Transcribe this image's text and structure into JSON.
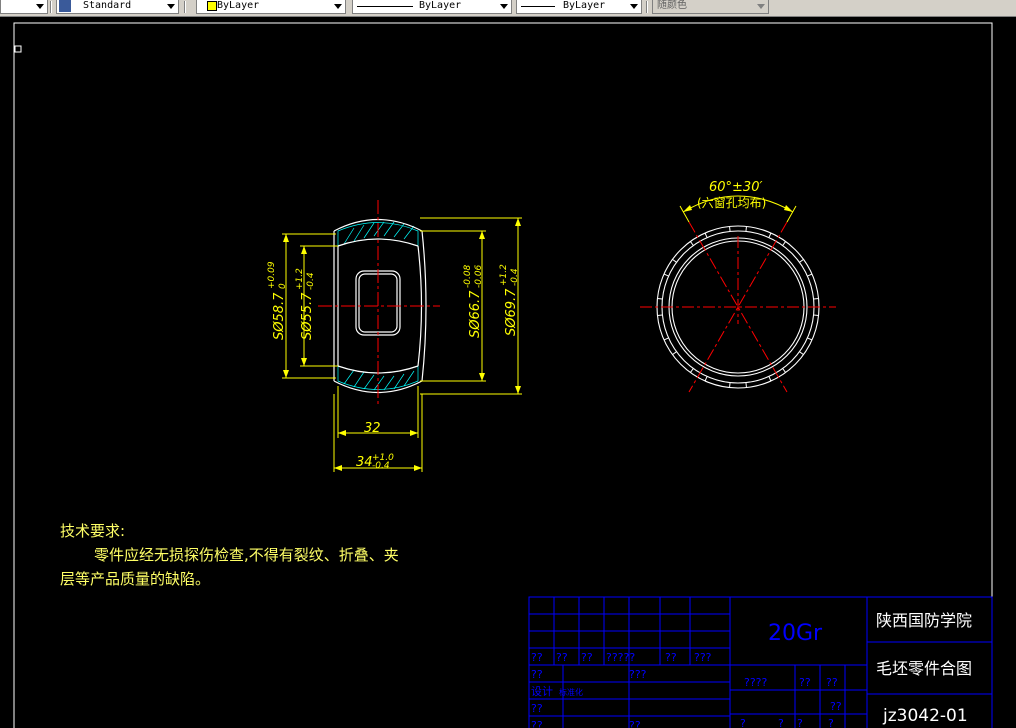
{
  "toolbar": {
    "textstyle_value": "Standard",
    "layer_color_value": "ByLayer",
    "linetype_value": "ByLayer",
    "lineweight_value": "ByLayer",
    "plotstyle_value": "随颜色"
  },
  "colors": {
    "background": "#000000",
    "object": "#ffffff",
    "dimension": "#ffff00",
    "centerline": "#ff0000",
    "hatch": "#00ffff",
    "titleblock": "#0000ff",
    "note": "#ffff66"
  },
  "drawing": {
    "dim_sphere_58": "SØ58.7",
    "dim_sphere_58_tol_upper": "+0.09",
    "dim_sphere_58_tol_lower": "0",
    "dim_sphere_55": "SØ55.7",
    "dim_sphere_55_tol_upper": "+1.2",
    "dim_sphere_55_tol_lower": "-0.4",
    "dim_sphere_66": "SØ66.7",
    "dim_sphere_66_tol_upper": "-0.08",
    "dim_sphere_66_tol_lower": "-0.06",
    "dim_sphere_69": "SØ69.7",
    "dim_sphere_69_tol_upper": "+1.2",
    "dim_sphere_69_tol_lower": "-0.4",
    "dim_width_32": "32",
    "dim_width_34": "34",
    "dim_width_34_tol_upper": "+1.0",
    "dim_width_34_tol_lower": "-0.4",
    "angle_label": "60°±30′",
    "angle_note": "(六窗孔均布)"
  },
  "notes": {
    "heading": "技术要求:",
    "line1": "零件应经无损探伤检查,不得有裂纹、折叠、夹",
    "line2": "层等产品质量的缺陷。"
  },
  "title_block": {
    "material": "20Gr",
    "school": "陕西国防学院",
    "title": "毛坯零件合图",
    "drawing_no": "jz3042-01",
    "placeholder_a": "??",
    "placeholder_b": "????",
    "placeholder_c": "?????",
    "placeholder_d": "???",
    "placeholder_e": "?",
    "label_design": "设计",
    "label_standard": "标准化",
    "label_approve": "审核"
  }
}
